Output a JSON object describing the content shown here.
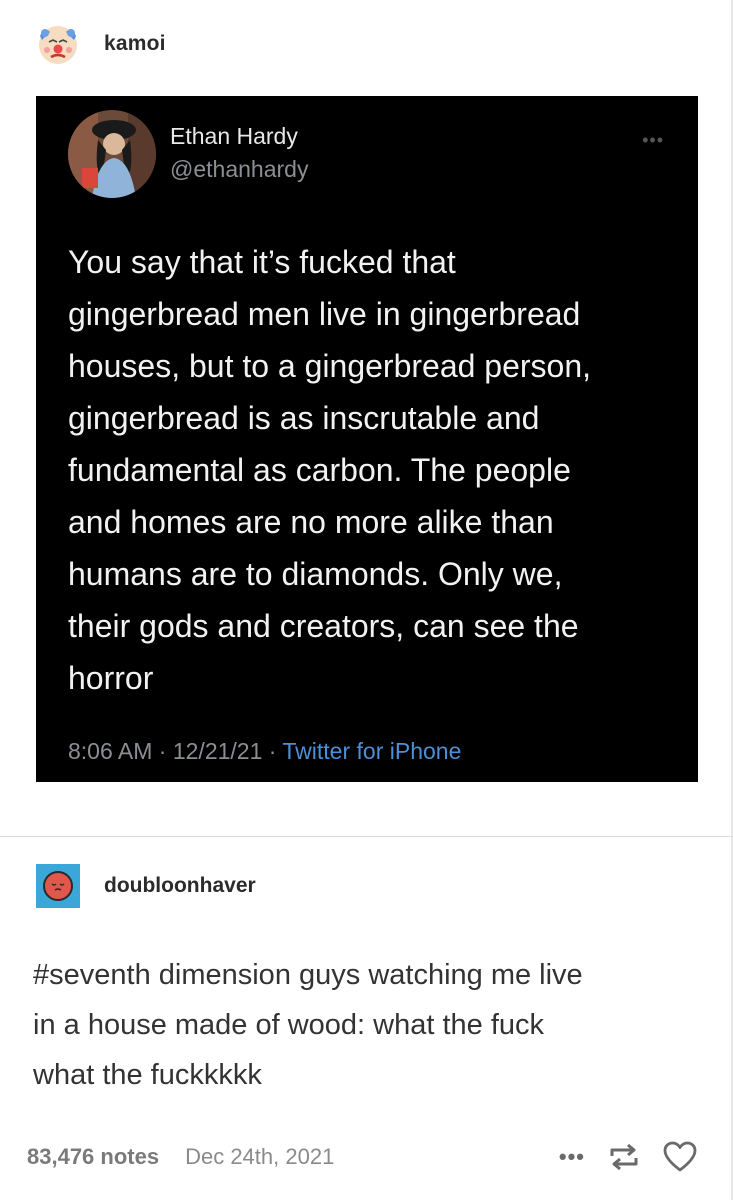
{
  "post": {
    "username": "kamoi",
    "avatar_icon": "clown-face-icon"
  },
  "tweet": {
    "name": "Ethan Hardy",
    "handle": "@ethanhardy",
    "text": "You say that it’s fucked that\ngingerbread men live in gingerbread\nhouses, but to a gingerbread person,\ngingerbread is as inscrutable and\nfundamental as carbon. The people\nand homes are no more alike than\nhumans are to diamonds. Only we,\ntheir gods and creators, can see the\nhorror",
    "time": "8:06 AM",
    "date": "12/21/21",
    "source": "Twitter for iPhone",
    "more_icon": "ellipsis-icon",
    "background": "#000000",
    "source_color": "#4c8fd6"
  },
  "reblog": {
    "username": "doubloonhaver",
    "avatar_icon": "red-face-icon",
    "text": "#seventh dimension guys watching me live\nin a house made of wood: what the fuck\nwhat the fuckkkkk"
  },
  "footer": {
    "notes": "83,476 notes",
    "date": "Dec 24th, 2021",
    "actions": [
      "more-icon",
      "reblog-icon",
      "heart-icon"
    ]
  }
}
